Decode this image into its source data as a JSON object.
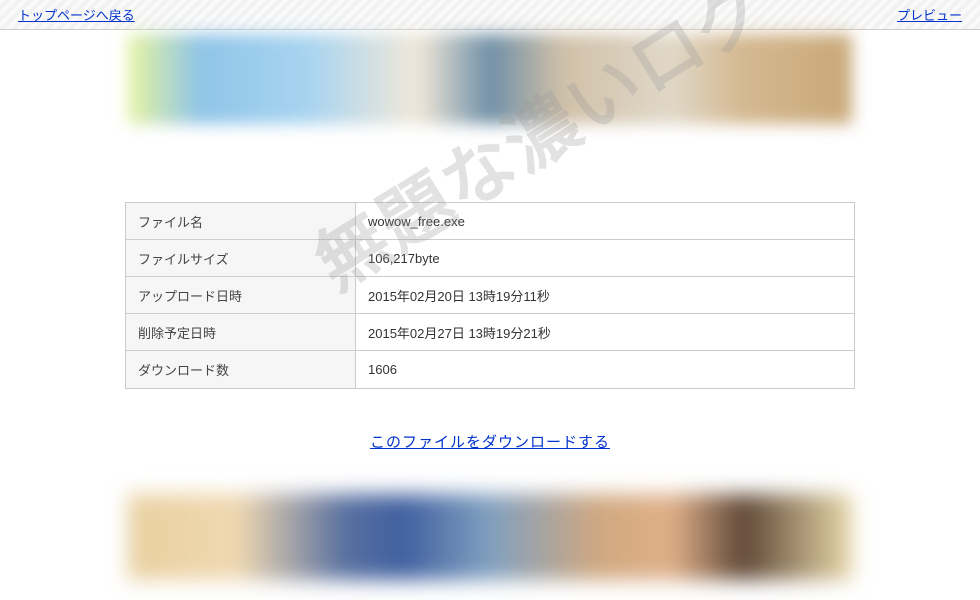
{
  "header": {
    "back_link": "トップページへ戻る",
    "preview_link": "プレビュー"
  },
  "watermark": "無題な濃いログ",
  "file_info": {
    "rows": [
      {
        "label": "ファイル名",
        "value": "wowow_free.exe"
      },
      {
        "label": "ファイルサイズ",
        "value": "106,217byte"
      },
      {
        "label": "アップロード日時",
        "value": "2015年02月20日 13時19分11秒"
      },
      {
        "label": "削除予定日時",
        "value": "2015年02月27日 13時19分21秒"
      },
      {
        "label": "ダウンロード数",
        "value": "1606"
      }
    ]
  },
  "download_link": "このファイルをダウンロードする"
}
